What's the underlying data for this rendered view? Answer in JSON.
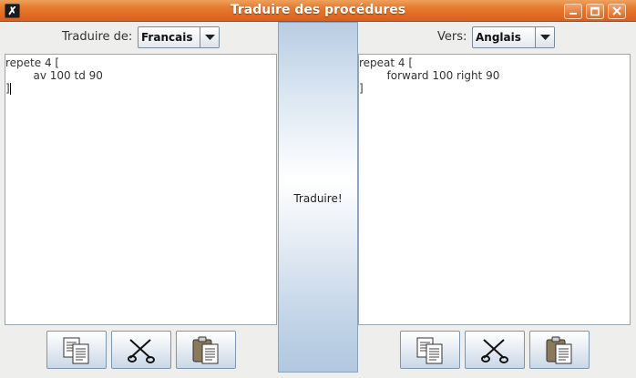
{
  "window": {
    "title": "Traduire des procédures"
  },
  "source": {
    "label": "Traduire de:",
    "language": "Francais",
    "lines": [
      "repete 4 [",
      "        av 100 td 90",
      "]"
    ]
  },
  "target": {
    "label": "Vers:",
    "language": "Anglais",
    "lines": [
      "repeat 4 [",
      "        forward 100 right 90",
      "]"
    ]
  },
  "translate_button": {
    "label": "Traduire!"
  },
  "toolbar_icons": [
    "copy-icon",
    "cut-icon",
    "paste-icon"
  ],
  "colors": {
    "titlebar": "#e6782d",
    "button_gradient_top": "#ffffff",
    "button_gradient_bottom": "#c9d7e6",
    "background": "#eeeeec"
  }
}
